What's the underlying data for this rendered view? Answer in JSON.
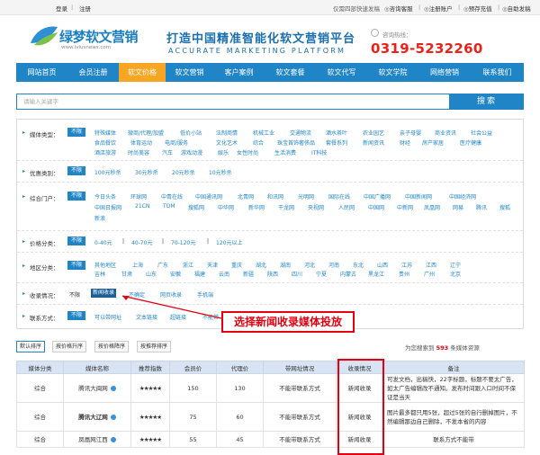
{
  "topbar": {
    "login": "登录",
    "sep": "|",
    "register": "注册",
    "info": "仅需四部快速发稿",
    "links": [
      "咨询客服",
      "注册账户",
      "预存充值",
      "自助发稿"
    ],
    "link_sep": "|"
  },
  "header": {
    "logo_name": "绿梦软文营销",
    "logo_url": "www.lvlusnews.com",
    "slogan": "打造中国精准智能化软文营销平台",
    "slogan_en": "ACCURATE MARKETING PLATFORM",
    "hotline_label": "咨询热线：",
    "phone": "0319-5232260"
  },
  "nav": {
    "items": [
      "网站首页",
      "会员注册",
      "软文价格",
      "软文营销",
      "客户案例",
      "软文套餐",
      "软文代写",
      "软文学院",
      "网络营销",
      "联系我们"
    ],
    "active_index": 2
  },
  "search": {
    "placeholder": "请输入关键字",
    "button": "搜索"
  },
  "filters": {
    "media_type": {
      "label": "媒体类型：",
      "nolimit": "不限",
      "row1": [
        "特殊媒体",
        "微商/代理/加盟",
        "低价小站",
        "法制商情",
        "机械工业",
        "交通物流",
        "酒水茶叶",
        "农业园艺",
        "亲子母婴",
        "商业资讯",
        "社会公益"
      ],
      "row2": [
        "食品餐饮",
        "体育运动",
        "电商/服务",
        "文化艺术",
        "综合",
        "珠宝首饰奢侈品",
        "套餐系列",
        "新闻资讯",
        "财经",
        "房产家居",
        "医疗健康"
      ],
      "row3": [
        "酒店旅游",
        "时尚美容",
        "汽车",
        "游戏动漫",
        "娱乐",
        "女性时尚",
        "生活消费",
        "IT科技"
      ]
    },
    "discount": {
      "label": "优惠类别：",
      "nolimit": "不限",
      "options": [
        "100元秒杀",
        "30元秒杀",
        "20元秒杀",
        "10元秒杀"
      ]
    },
    "portal": {
      "label": "综合门户：",
      "nolimit": "不限",
      "row1": [
        "今日头条",
        "环球网",
        "中青在线",
        "中国通讯网",
        "北青网",
        "和讯网",
        "光明网",
        "国际在线",
        "中国广播网",
        "中国新闻网",
        "中国经济网"
      ],
      "row2": [
        "中国日报网",
        "21CN",
        "TOM",
        "搜狐网",
        "中华网",
        "新华网",
        "干龙网",
        "央视网",
        "人民网",
        "中国网",
        "中新网",
        "凤凰网",
        "网易",
        "腾讯",
        "搜狐"
      ],
      "row3": [
        "新浪"
      ]
    },
    "price": {
      "label": "价格分类：",
      "nolimit": "不限",
      "options": [
        "0-40元",
        "40-70元",
        "70-120元",
        "120元以上"
      ],
      "sep": "|"
    },
    "region": {
      "label": "地区分类：",
      "nolimit": "不限",
      "row1": [
        "其他地区",
        "上海",
        "广东",
        "浙江",
        "天津",
        "重庆",
        "湖北",
        "湖南",
        "河北",
        "河南",
        "东北",
        "山西",
        "江苏",
        "江西",
        "辽宁"
      ],
      "row2": [
        "吉林",
        "甘肃",
        "山东",
        "安徽",
        "福建",
        "云南",
        "新疆",
        "陕西",
        "四川",
        "宁夏",
        "内蒙古",
        "黑龙江",
        "贵州",
        "广州",
        "北京"
      ]
    },
    "indexing": {
      "label": "收录情况：",
      "options": [
        "不限",
        "新闻收录",
        "不确定",
        "网页收录",
        "手机端"
      ],
      "selected_index": 1
    },
    "link": {
      "label": "联系方式：",
      "nolimit": "不限",
      "options": [
        "可以带网址",
        "文本链接",
        "超链接",
        "不能带"
      ]
    }
  },
  "annotation": "选择新闻收录媒体投放",
  "sort": {
    "buttons": [
      "默认排序",
      "按价格升序",
      "按价格降序",
      "按推荐排序"
    ],
    "active_index": 0,
    "total_prefix": "为您搜索到",
    "total_count": "593",
    "total_suffix": "条媒体资源"
  },
  "table": {
    "headers": [
      "媒体分类",
      "媒体名称",
      "推荐指数",
      "会员价",
      "代理价",
      "带网址情况",
      "收录情况",
      "备注"
    ],
    "rows": [
      {
        "cat": "综合",
        "name": "腾讯大闽网",
        "stars": "★★★★★",
        "member": "150",
        "agent": "130",
        "url": "不能带联系方式",
        "index": "新闻收录",
        "note": "可发文档，出稿快，22字标题，标题不要太广告，如太广告编辑改不通知。发布时间跟入口时间不保证是当天"
      },
      {
        "cat": "综合",
        "name": "腾讯大辽网",
        "stars": "★★★★★",
        "member": "75",
        "agent": "60",
        "url": "不能带联系方式",
        "index": "新闻收录",
        "note": "图片最多都只用5张，超过5张的自行删掉图片，不然编辑那边自己删除，不发本省的内容"
      },
      {
        "cat": "综合",
        "name": "凤凰网江西",
        "stars": "★★★★★",
        "member": "55",
        "agent": "45",
        "url": "不能带联系方式",
        "index": "新闻收录",
        "note": "联系方式不能带"
      }
    ]
  }
}
